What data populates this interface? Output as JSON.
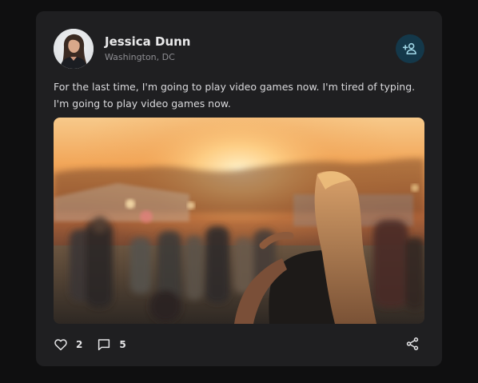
{
  "post": {
    "author": {
      "name": "Jessica Dunn",
      "location": "Washington, DC",
      "avatar_icon": "avatar-photo"
    },
    "follow_button": {
      "icon": "person-add-icon",
      "color": "#14384a"
    },
    "text": "For the last time, I'm going to play video games now. I'm tired of typing. I'm going to play video games now.",
    "image": {
      "subject": "festival-sunset-photo"
    },
    "actions": {
      "likes": {
        "icon": "heart-outline-icon",
        "count": "2"
      },
      "comments": {
        "icon": "comment-icon",
        "count": "5"
      },
      "share": {
        "icon": "share-icon"
      }
    }
  },
  "theme": {
    "page_bg": "#0f0f10",
    "card_bg": "#1f1f21",
    "text_primary": "#e9e9ea",
    "text_secondary": "#8d8d92"
  }
}
